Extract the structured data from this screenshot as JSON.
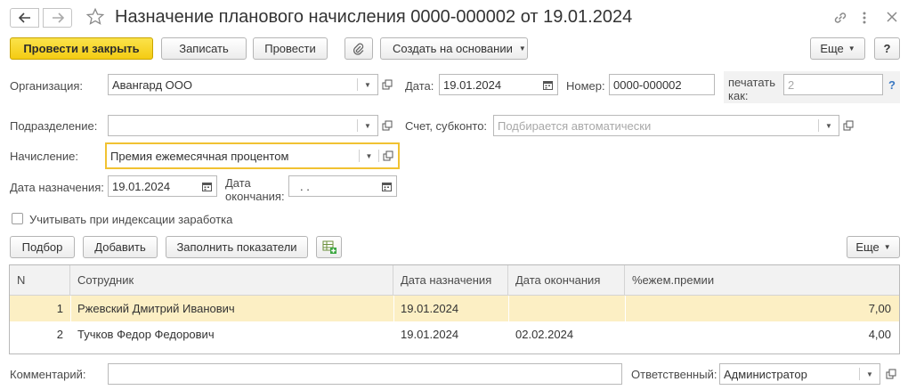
{
  "window": {
    "title": "Назначение планового начисления 0000-000002 от 19.01.2024"
  },
  "toolbar": {
    "post_close_label": "Провести и закрыть",
    "save_label": "Записать",
    "post_label": "Провести",
    "create_basis_label": "Создать на основании",
    "more_label": "Еще",
    "help_label": "?"
  },
  "form": {
    "organization_label": "Организация:",
    "organization_value": "Авангард ООО",
    "date_label": "Дата:",
    "date_value": "19.01.2024",
    "number_label": "Номер:",
    "number_value": "0000-000002",
    "print_as_label": "печатать как:",
    "print_as_placeholder": "2",
    "print_help": "?",
    "department_label": "Подразделение:",
    "department_value": "",
    "account_label": "Счет, субконто:",
    "account_placeholder": "Подбирается автоматически",
    "accrual_label": "Начисление:",
    "accrual_value": "Премия ежемесячная процентом",
    "assign_date_label": "Дата назначения:",
    "assign_date_value": "19.01.2024",
    "end_date_label": "Дата окончания:",
    "end_date_value": " .  .",
    "indexation_label": "Учитывать при индексации заработка",
    "indexation_checked": false,
    "comment_label": "Комментарий:",
    "comment_value": "",
    "responsible_label": "Ответственный:",
    "responsible_value": "Администратор"
  },
  "table_toolbar": {
    "pick_label": "Подбор",
    "add_label": "Добавить",
    "fill_label": "Заполнить показатели",
    "more_label": "Еще"
  },
  "table": {
    "columns": [
      "N",
      "Сотрудник",
      "Дата назначения",
      "Дата окончания",
      "%ежем.премии"
    ],
    "rows": [
      {
        "n": "1",
        "employee": "Ржевский Дмитрий Иванович",
        "start": "19.01.2024",
        "end": "",
        "percent": "7,00",
        "selected": true
      },
      {
        "n": "2",
        "employee": "Тучков Федор Федорович",
        "start": "19.01.2024",
        "end": "02.02.2024",
        "percent": "4,00",
        "selected": false
      }
    ]
  },
  "colors": {
    "primary": "#f4cc13",
    "selected_row": "#fcefc4",
    "focus_border": "#f1c232",
    "help_link": "#3a78c2"
  }
}
